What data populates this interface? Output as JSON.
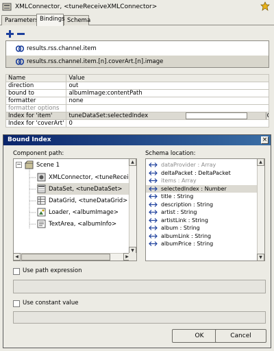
{
  "window": {
    "title": "XMLConnector, <tuneReceiveXMLConnector>"
  },
  "tabs": [
    {
      "label": "Parameters",
      "active": false
    },
    {
      "label": "Bindings",
      "active": true
    },
    {
      "label": "Schema",
      "active": false
    }
  ],
  "bindings": [
    "results.rss.channel.item",
    "results.rss.channel.item.[n].coverArt.[n].image"
  ],
  "properties": {
    "header": {
      "name": "Name",
      "value": "Value"
    },
    "rows": [
      {
        "name": "direction",
        "value": "out"
      },
      {
        "name": "bound to",
        "value": "albumImage:contentPath"
      },
      {
        "name": "formatter",
        "value": "none"
      },
      {
        "name": "formatter options",
        "value": ""
      },
      {
        "name": "Index for 'item'",
        "value": "tuneDataSet:selectedIndex"
      },
      {
        "name": "Index for 'coverArt'",
        "value": "0"
      }
    ]
  },
  "dialog": {
    "title": "Bound Index",
    "component_path_label": "Component path:",
    "schema_location_label": "Schema location:",
    "tree": [
      {
        "label": "Scene 1",
        "icon": "scene-icon"
      },
      {
        "label": "XMLConnector, <tuneReceiveXMLC",
        "icon": "connector-icon"
      },
      {
        "label": "DataSet, <tuneDataSet>",
        "icon": "dataset-icon"
      },
      {
        "label": "DataGrid, <tuneDataGrid>",
        "icon": "datagrid-icon"
      },
      {
        "label": "Loader, <albumImage>",
        "icon": "loader-icon"
      },
      {
        "label": "TextArea, <albumInfo>",
        "icon": "textarea-icon"
      }
    ],
    "schema": [
      {
        "label": "dataProvider : Array",
        "dim": true
      },
      {
        "label": "deltaPacket : DeltaPacket",
        "dim": false
      },
      {
        "label": "items : Array",
        "dim": true
      },
      {
        "label": "selectedIndex : Number",
        "dim": false
      },
      {
        "label": "title : String",
        "dim": false
      },
      {
        "label": "description : String",
        "dim": false
      },
      {
        "label": "artist : String",
        "dim": false
      },
      {
        "label": "artistLink : String",
        "dim": false
      },
      {
        "label": "album : String",
        "dim": false
      },
      {
        "label": "albumLink : String",
        "dim": false
      },
      {
        "label": "albumPrice : String",
        "dim": false
      }
    ],
    "use_path_expression_label": "Use path expression",
    "use_constant_value_label": "Use constant value",
    "ok_label": "OK",
    "cancel_label": "Cancel"
  },
  "colors": {
    "dialog_title_start": "#0a246a",
    "dialog_title_end": "#3a6ea5",
    "binding_icon": "#1c3f9c",
    "arrow": "#1c3f9c"
  }
}
